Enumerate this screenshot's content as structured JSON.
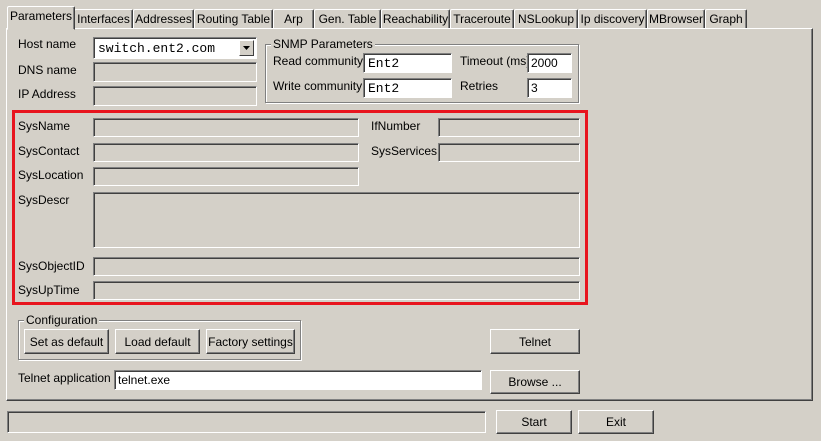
{
  "tabs": [
    {
      "label": "Parameters",
      "active": true
    },
    {
      "label": "Interfaces"
    },
    {
      "label": "Addresses"
    },
    {
      "label": "Routing Table"
    },
    {
      "label": "Arp"
    },
    {
      "label": "Gen. Table"
    },
    {
      "label": "Reachability"
    },
    {
      "label": "Traceroute"
    },
    {
      "label": "NSLookup"
    },
    {
      "label": "Ip discovery"
    },
    {
      "label": "MBrowser"
    },
    {
      "label": "Graph"
    }
  ],
  "host": {
    "host_name_label": "Host name",
    "host_name_value": "switch.ent2.com",
    "dns_name_label": "DNS name",
    "dns_name_value": "",
    "ip_address_label": "IP Address",
    "ip_address_value": ""
  },
  "snmp": {
    "title": "SNMP Parameters",
    "read_community_label": "Read community",
    "read_community_value": "Ent2",
    "write_community_label": "Write community",
    "write_community_value": "Ent2",
    "timeout_label": "Timeout (ms)",
    "timeout_value": "2000",
    "retries_label": "Retries",
    "retries_value": "3"
  },
  "system": {
    "sysname_label": "SysName",
    "syscontact_label": "SysContact",
    "syslocation_label": "SysLocation",
    "sysdescr_label": "SysDescr",
    "sysobjectid_label": "SysObjectID",
    "sysuptime_label": "SysUpTime",
    "ifnumber_label": "IfNumber",
    "sysservices_label": "SysServices",
    "highlight_color": "#e8141e"
  },
  "configuration": {
    "title": "Configuration",
    "set_default_label": "Set as default",
    "load_default_label": "Load default",
    "factory_settings_label": "Factory settings"
  },
  "telnet": {
    "button_label": "Telnet",
    "app_label": "Telnet application",
    "app_value": "telnet.exe",
    "browse_label": "Browse ..."
  },
  "footer": {
    "start_label": "Start",
    "exit_label": "Exit"
  }
}
